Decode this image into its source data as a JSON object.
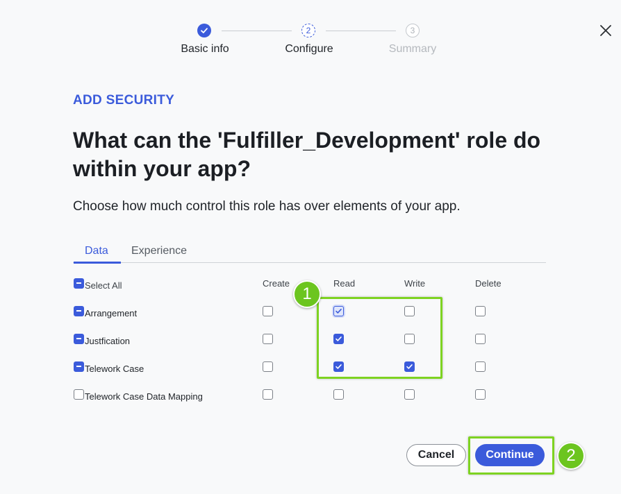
{
  "stepper": {
    "steps": [
      {
        "number": "",
        "label": "Basic info",
        "state": "done"
      },
      {
        "number": "2",
        "label": "Configure",
        "state": "current"
      },
      {
        "number": "3",
        "label": "Summary",
        "state": "future"
      }
    ]
  },
  "header": {
    "eyebrow": "ADD SECURITY",
    "title": "What can the 'Fulfiller_Development' role do within your app?",
    "subtitle": "Choose how much control this role has over elements of your app."
  },
  "tabs": [
    {
      "label": "Data",
      "active": true
    },
    {
      "label": "Experience",
      "active": false
    }
  ],
  "table": {
    "select_all_label": "Select All",
    "columns": [
      "Create",
      "Read",
      "Write",
      "Delete"
    ],
    "rows": [
      {
        "label": "Arrangement",
        "row_state": "partial",
        "create": false,
        "read": true,
        "write": false,
        "delete": false
      },
      {
        "label": "Justfication",
        "row_state": "partial",
        "create": false,
        "read": true,
        "write": false,
        "delete": false
      },
      {
        "label": "Telework Case",
        "row_state": "partial",
        "create": false,
        "read": true,
        "write": true,
        "delete": false
      },
      {
        "label": "Telework Case Data Mapping",
        "row_state": "unchecked",
        "create": false,
        "read": false,
        "write": false,
        "delete": false
      }
    ]
  },
  "annotations": {
    "badge_1": "1",
    "badge_2": "2",
    "highlight_color": "#7ed321"
  },
  "footer": {
    "cancel_label": "Cancel",
    "continue_label": "Continue"
  },
  "colors": {
    "accent": "#3b5bdb",
    "background": "#f8f9fa"
  },
  "icons": {
    "close": "close-icon",
    "step_done": "check-icon"
  }
}
